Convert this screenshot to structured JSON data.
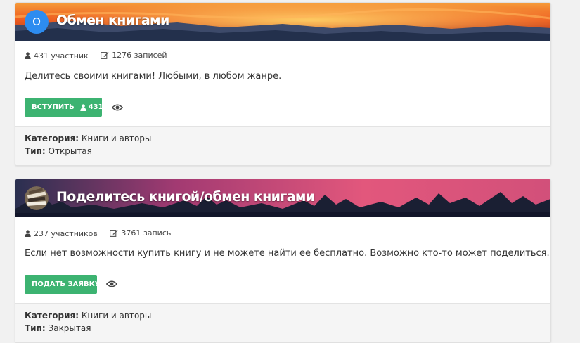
{
  "groups": [
    {
      "avatar_letter": "О",
      "title": "Обмен книгами",
      "participants": "431 участник",
      "posts": "1276 записей",
      "description": "Делитесь своими книгами! Любыми, в любом жанре.",
      "action_label": "ВСТУПИТЬ",
      "action_count": "431",
      "category_label": "Категория:",
      "category_value": "Книги и авторы",
      "type_label": "Тип:",
      "type_value": "Открытая"
    },
    {
      "title": "Поделитесь книгой/обмен книгами",
      "participants": "237 участников",
      "posts": "3761 запись",
      "description": "Если нет возможности купить книгу и не можете найти ее бесплатно. Возможно кто-то может поделиться.",
      "action_label": "ПОДАТЬ ЗАЯВКУ",
      "category_label": "Категория:",
      "category_value": "Книги и авторы",
      "type_label": "Тип:",
      "type_value": "Закрытая"
    }
  ],
  "icons": {
    "participants": "user-icon",
    "posts": "edit-icon",
    "view": "eye-icon"
  },
  "colors": {
    "accent_green": "#3cb371",
    "avatar_blue": "#2d8cf0"
  }
}
